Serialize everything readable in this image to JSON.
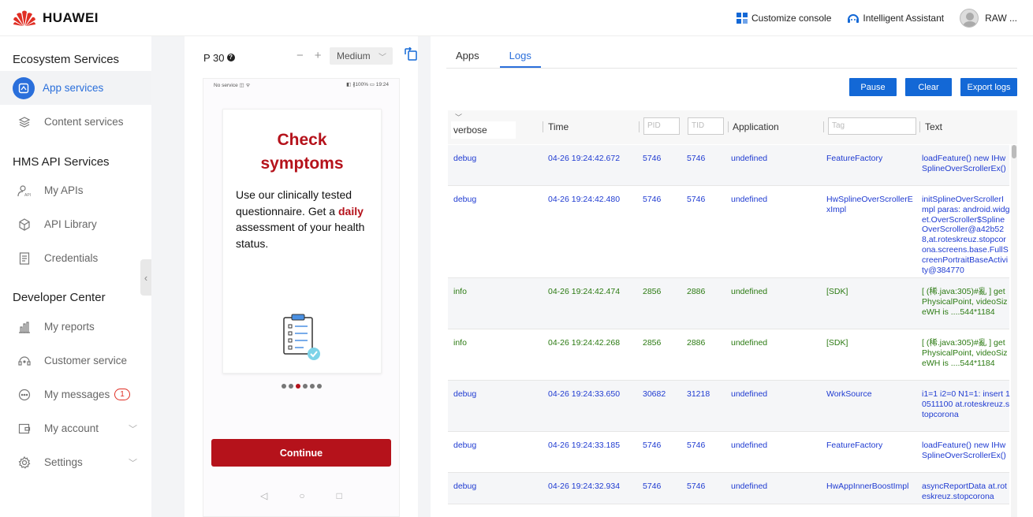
{
  "brand": {
    "name": "HUAWEI",
    "logo_color": "#e02e24"
  },
  "topbar": {
    "customize": "Customize console",
    "assistant": "Intelligent Assistant",
    "user": "RAW ..."
  },
  "sidebar": {
    "sections": [
      "Ecosystem Services",
      "HMS API Services",
      "Developer Center"
    ],
    "items": [
      {
        "label": "App services",
        "icon": "app-services-icon",
        "active": true
      },
      {
        "label": "Content services",
        "icon": "layers-icon"
      },
      {
        "label": "My APIs",
        "icon": "api-user-icon"
      },
      {
        "label": "API Library",
        "icon": "cube-icon"
      },
      {
        "label": "Credentials",
        "icon": "document-icon"
      },
      {
        "label": "My reports",
        "icon": "bar-chart-icon"
      },
      {
        "label": "Customer service",
        "icon": "headset-icon"
      },
      {
        "label": "My messages",
        "icon": "chat-icon",
        "badge": "1"
      },
      {
        "label": "My account",
        "icon": "wallet-icon"
      },
      {
        "label": "Settings",
        "icon": "gear-icon"
      }
    ]
  },
  "device": {
    "model": "P 30",
    "size": "Medium",
    "status_left": "No service ◫ ᯤ",
    "status_right": "◧ ∦100% ▭ 19:24",
    "card_title": "Check symptoms",
    "card_body_1": "Use our clinically tested questionnaire. Get a ",
    "card_body_hl": "daily",
    "card_body_2": " assessment of your health status.",
    "continue": "Continue",
    "page_index": 3,
    "page_count": 6,
    "accent": "#b5121b"
  },
  "logs": {
    "tabs": [
      "Apps",
      "Logs"
    ],
    "active_tab": "Logs",
    "buttons": {
      "pause": "Pause",
      "clear": "Clear",
      "export": "Export logs"
    },
    "level_filter": "verbose",
    "columns": {
      "time": "Time",
      "application": "Application",
      "text": "Text"
    },
    "placeholders": {
      "pid": "PID",
      "tid": "TID",
      "tag": "Tag"
    },
    "rows": [
      {
        "level": "debug",
        "time": "04-26 19:24:42.672",
        "pid": "5746",
        "tid": "5746",
        "app": "undefined",
        "tag": "FeatureFactory",
        "text": "loadFeature() new IHwSplineOverScrollerEx()"
      },
      {
        "level": "debug",
        "time": "04-26 19:24:42.480",
        "pid": "5746",
        "tid": "5746",
        "app": "undefined",
        "tag": "HwSplineOverScrollerExImpl",
        "text": "initSplineOverScrollerImpl paras: android.widget.OverScroller$SplineOverScroller@a42b528,at.roteskreuz.stopcorona.screens.base.FullScreenPortraitBaseActivity@384770"
      },
      {
        "level": "info",
        "time": "04-26 19:24:42.474",
        "pid": "2856",
        "tid": "2886",
        "app": "undefined",
        "tag": "[SDK]",
        "text": "[ (稀.java:305)#亂 ] getPhysicalPoint, videoSizeWH is ....544*1184"
      },
      {
        "level": "info",
        "time": "04-26 19:24:42.268",
        "pid": "2856",
        "tid": "2886",
        "app": "undefined",
        "tag": "[SDK]",
        "text": "[ (稀.java:305)#亂 ] getPhysicalPoint, videoSizeWH is ....544*1184"
      },
      {
        "level": "debug",
        "time": "04-26 19:24:33.650",
        "pid": "30682",
        "tid": "31218",
        "app": "undefined",
        "tag": "WorkSource",
        "text": "i1=1 i2=0 N1=1: insert 10511100 at.roteskreuz.stopcorona"
      },
      {
        "level": "debug",
        "time": "04-26 19:24:33.185",
        "pid": "5746",
        "tid": "5746",
        "app": "undefined",
        "tag": "FeatureFactory",
        "text": "loadFeature() new IHwSplineOverScrollerEx()"
      },
      {
        "level": "debug",
        "time": "04-26 19:24:32.934",
        "pid": "5746",
        "tid": "5746",
        "app": "undefined",
        "tag": "HwAppInnerBoostImpl",
        "text": "asyncReportData at.roteskreuz.stopcorona"
      }
    ]
  }
}
